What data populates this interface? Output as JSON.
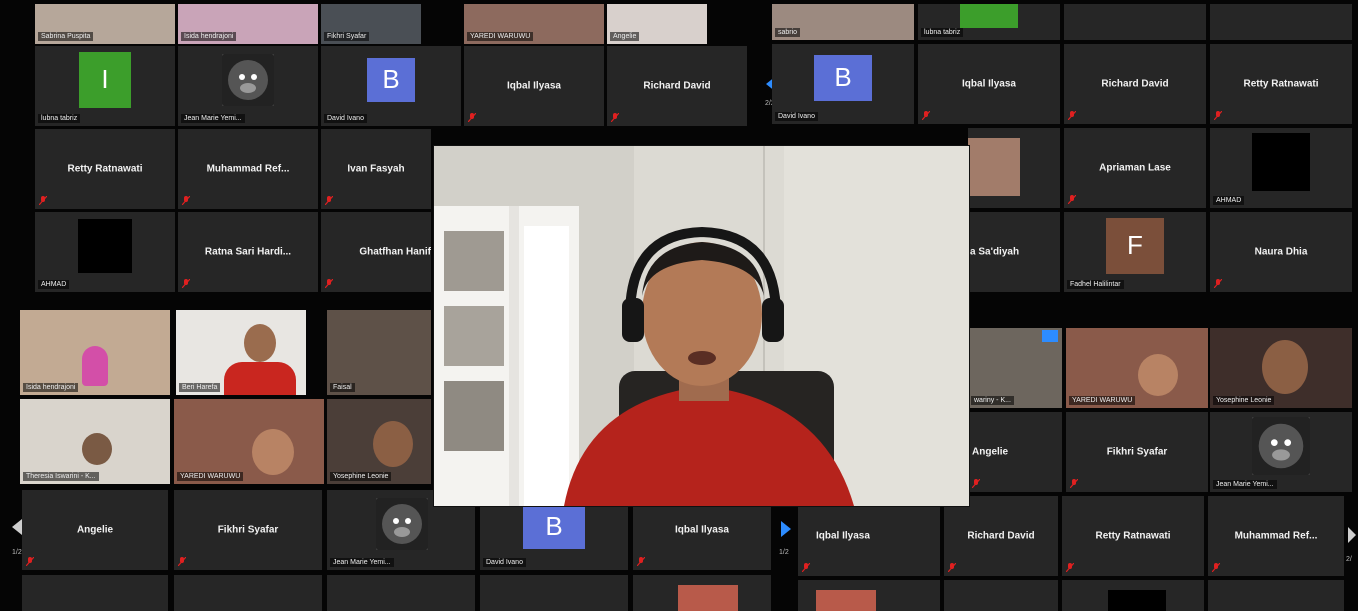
{
  "colors": {
    "tile_bg": "#262626",
    "mute_red": "#e02020",
    "avatar_i": "#3c9e2b",
    "avatar_b": "#5b6fd6",
    "avatar_f": "#7b4f3a",
    "nav_blue": "#2d8cff"
  },
  "left_top_captions": [
    "Sabrina Puspita",
    "Isida hendrajoni",
    "Fikhri Syafar",
    "YAREDI WARUWU",
    "Angelie"
  ],
  "left_row2": {
    "i_caption": "lubna tabriz",
    "i_letter": "I",
    "gorilla_caption": "Jean Marie Yemi...",
    "b_letter": "B",
    "b_caption": "David Ivano",
    "name1": "Iqbal Ilyasa",
    "name2": "Richard David"
  },
  "left_row3": {
    "name1": "Retty Ratnawati",
    "name2": "Muhammad Ref...",
    "name3": "Ivan Fasyah"
  },
  "left_row4": {
    "black_caption": "AHMAD",
    "name1": "Ratna Sari Hardi...",
    "name2": "Ghatfhan Hanif"
  },
  "left_video_captions": [
    "Isida hendrajoni",
    "Beri Harefa",
    "Faisal",
    "Theresia Iswarini - K...",
    "YAREDI WARUWU",
    "Yosephine Leonie"
  ],
  "left_bottom": {
    "name1": "Angelie",
    "name2": "Fikhri Syafar",
    "gorilla_caption": "Jean Marie Yemi...",
    "b_letter": "B",
    "b_caption": "David Ivano",
    "name3": "Iqbal Ilyasa"
  },
  "page_indicators": {
    "left_mid": "2/2",
    "left_bottom": "1/2",
    "right_bottom": "1/2",
    "far_right": "2/"
  },
  "right_top_captions": [
    "sabrio",
    "lubna tabriz"
  ],
  "right_row2": {
    "b_letter": "B",
    "b_caption": "David Ivano",
    "name1": "Iqbal Ilyasa",
    "name2": "Richard David",
    "name3": "Retty Ratnawati"
  },
  "right_row3": {
    "name1": "Apriaman Lase",
    "black_caption": "AHMAD"
  },
  "right_row4": {
    "name_partial": "a Sa'diyah",
    "f_letter": "F",
    "f_caption": "Fadhel Halilintar",
    "name1": "Naura Dhia"
  },
  "right_video_captions": [
    "wariny - K...",
    "YAREDI WARUWU",
    "Yosephine Leonie"
  ],
  "right_row6": {
    "name1": "Angelie",
    "name2": "Fikhri Syafar",
    "gorilla_caption": "Jean Marie Yemi..."
  },
  "right_bottom": {
    "name1": "Iqbal Ilyasa",
    "name2": "Richard David",
    "name3": "Retty Ratnawati",
    "name4": "Muhammad Ref..."
  }
}
